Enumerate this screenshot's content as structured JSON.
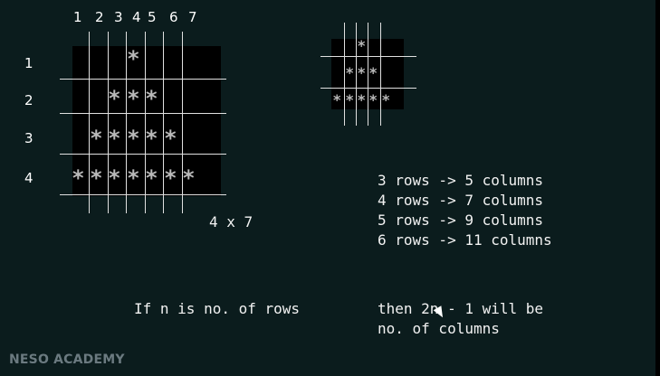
{
  "left_grid": {
    "column_labels": [
      "1",
      "2",
      "3",
      "4",
      "5",
      "6",
      "7"
    ],
    "row_labels": [
      "1",
      "2",
      "3",
      "4"
    ],
    "star_symbol": "*",
    "rows_star_counts": [
      1,
      3,
      5,
      7
    ],
    "dimension_label": "4 x 7"
  },
  "right_grid": {
    "star_symbol": "*",
    "rows_star_counts": [
      1,
      3,
      5
    ]
  },
  "rules": [
    "3 rows -> 5 columns",
    "4 rows -> 7 columns",
    "5 rows -> 9 columns",
    "6 rows -> 11 columns"
  ],
  "formula": {
    "condition": "If n is no. of rows",
    "result_line1": "then 2n - 1 will be",
    "result_line2": "no. of columns"
  },
  "watermark": "NESO ACADEMY",
  "colors": {
    "background": "#0b1c1d",
    "grid_box": "#000000",
    "star": "#b9b9b9",
    "text": "#f2f2f2"
  }
}
